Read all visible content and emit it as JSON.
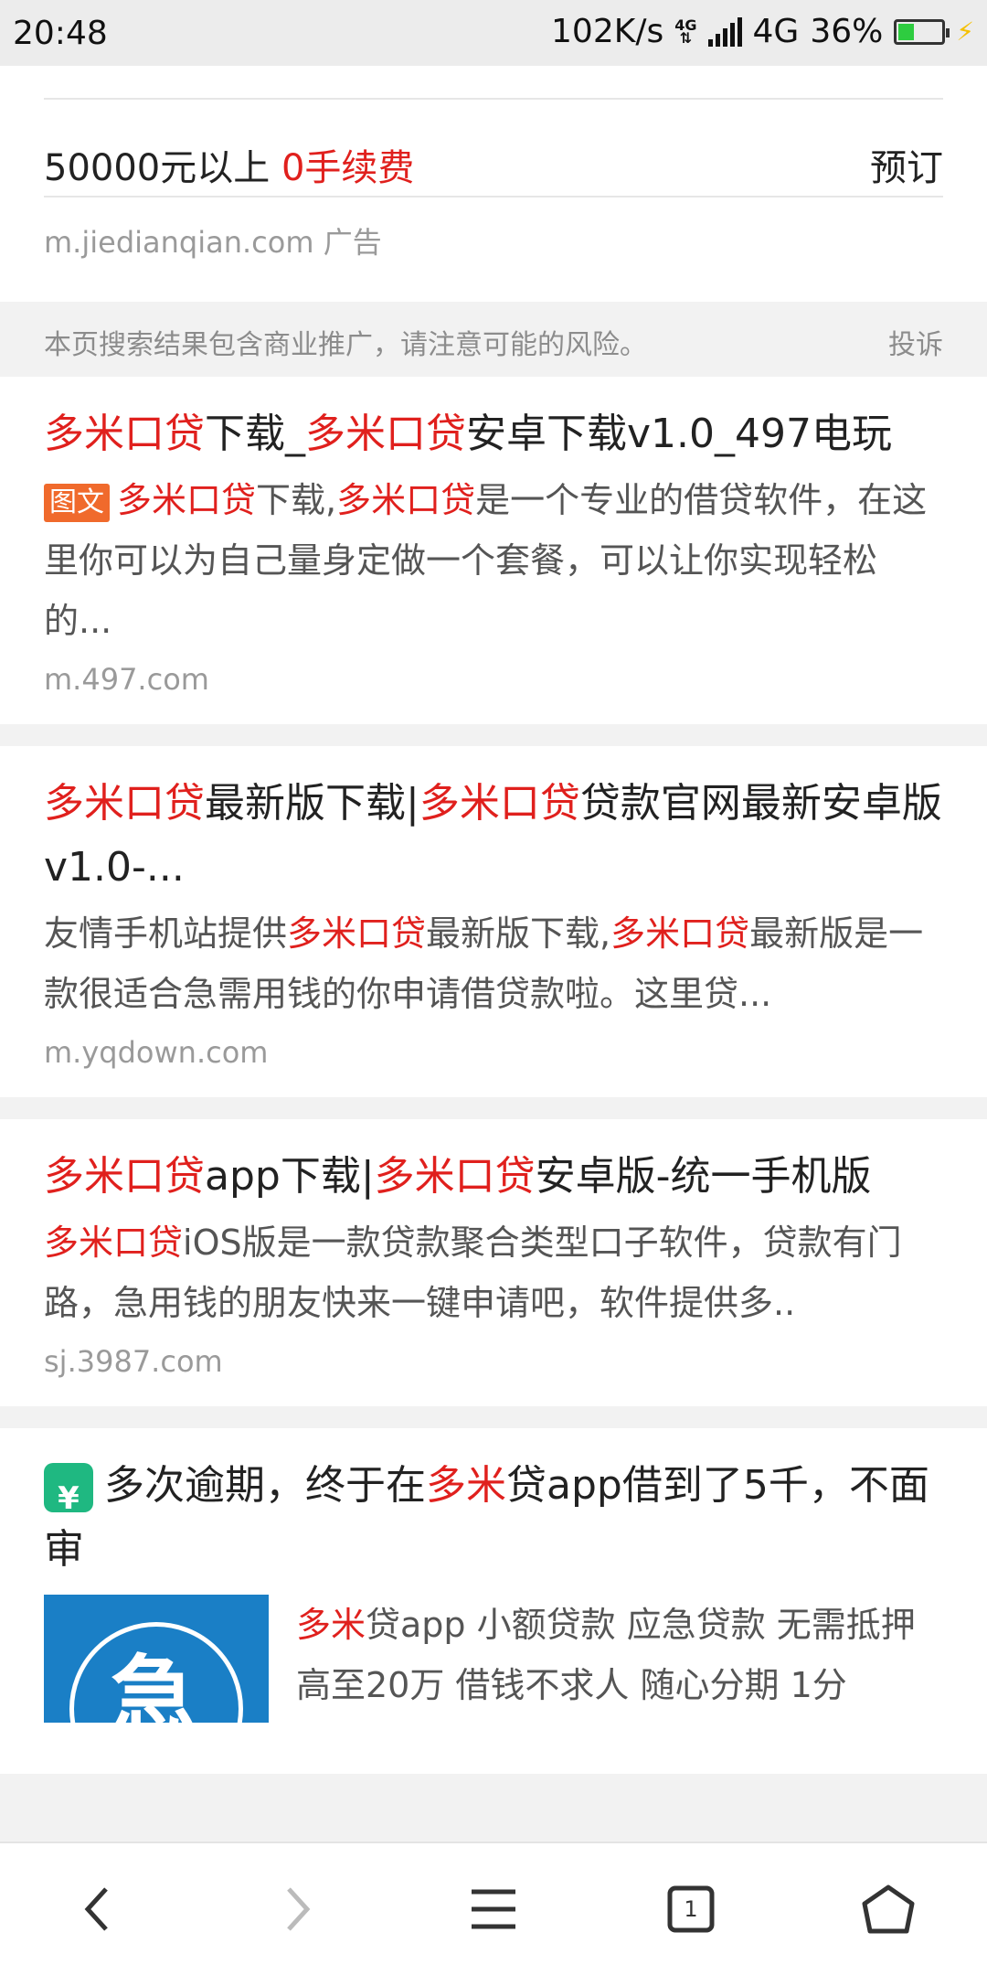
{
  "status_bar": {
    "time": "20:48",
    "speed": "102K/s",
    "network": "4G",
    "battery_percent": "36%",
    "battery_level": 0.36
  },
  "ad": {
    "line_prefix": "50000元以上",
    "line_highlight": "0手续费",
    "reserve_label": "预订",
    "domain": "m.jiedianqian.com",
    "ad_label": "广告"
  },
  "notice": {
    "text": "本页搜索结果包含商业推广，请注意可能的风险。",
    "complain_label": "投诉"
  },
  "results": [
    {
      "title_parts": [
        "多米口贷",
        "下载_",
        "多米口贷",
        "安卓下载v1.0_497电玩"
      ],
      "tag": "图文",
      "desc_parts": [
        "多米口贷",
        "下载,",
        "多米口贷",
        "是一个专业的借贷软件，在这里你可以为自己量身定做一个套餐，可以让你实现轻松的..."
      ],
      "url": "m.497.com"
    },
    {
      "title_parts": [
        "多米口贷",
        "最新版下载|",
        "多米口贷",
        "贷款官网最新安卓版 v1.0-..."
      ],
      "desc_parts": [
        "友情手机站提供",
        "多米口贷",
        "最新版下载,",
        "多米口贷",
        "最新版是一款很适合急需用钱的你申请借贷款啦。这里贷..."
      ],
      "url": "m.yqdown.com"
    },
    {
      "title_parts": [
        "多米口贷",
        "app下载|",
        "多米口贷",
        "安卓版-统一手机版"
      ],
      "desc_parts": [
        "多米口贷",
        "iOS版是一款贷款聚合类型口子软件，贷款有门路，急用钱的朋友快来一键申请吧，软件提供多.."
      ],
      "url": "sj.3987.com"
    }
  ],
  "article": {
    "title_parts": [
      "多次逾期，终于在",
      "多米",
      "贷app借到了5千，不面审"
    ],
    "desc_parts": [
      "多米",
      "贷app 小额贷款 应急贷款 无需抵押 高至20万 借钱不求人 随心分期 1分"
    ],
    "thumb_glyph": "急"
  },
  "bottom_nav": {
    "tab_count": "1",
    "icons": [
      "back-icon",
      "forward-icon",
      "menu-icon",
      "tabs-icon",
      "home-icon"
    ]
  }
}
